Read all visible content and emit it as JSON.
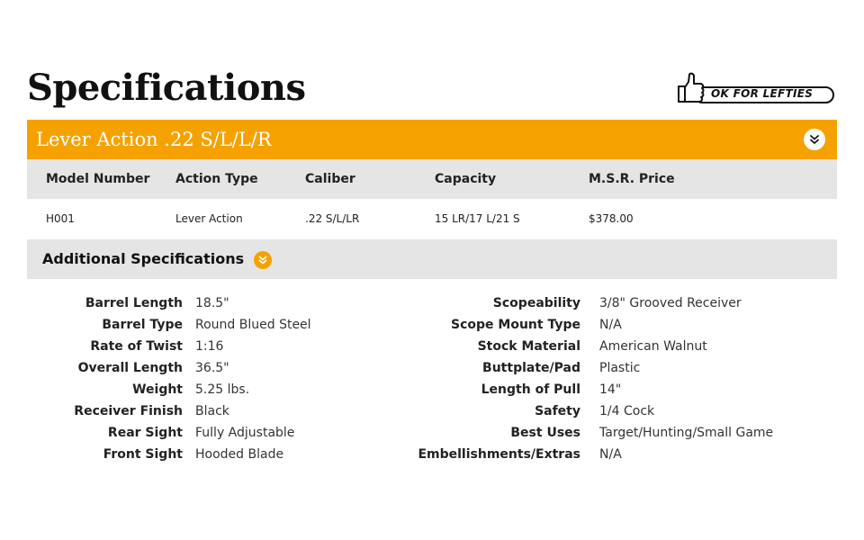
{
  "page_title": "Specifications",
  "badge": {
    "text": "OK FOR LEFTIES",
    "icon": "thumbs-up-icon"
  },
  "product": {
    "name": "Lever Action .22 S/L/L/R",
    "toggle_icon": "chevron-double-down-icon"
  },
  "table": {
    "headers": [
      "Model Number",
      "Action Type",
      "Caliber",
      "Capacity",
      "M.S.R. Price"
    ],
    "row": [
      "H001",
      "Lever Action",
      ".22 S/L/LR",
      "15 LR/17 L/21 S",
      "$378.00"
    ]
  },
  "additional": {
    "title": "Additional Specifications",
    "toggle_icon": "chevron-double-down-icon",
    "left": [
      {
        "label": "Barrel Length",
        "value": "18.5\""
      },
      {
        "label": "Barrel Type",
        "value": "Round Blued Steel"
      },
      {
        "label": "Rate of Twist",
        "value": "1:16"
      },
      {
        "label": "Overall Length",
        "value": "36.5\""
      },
      {
        "label": "Weight",
        "value": "5.25 lbs."
      },
      {
        "label": "Receiver Finish",
        "value": "Black"
      },
      {
        "label": "Rear Sight",
        "value": "Fully Adjustable"
      },
      {
        "label": "Front Sight",
        "value": "Hooded Blade"
      }
    ],
    "right": [
      {
        "label": "Scopeability",
        "value": "3/8\" Grooved Receiver"
      },
      {
        "label": "Scope Mount Type",
        "value": "N/A"
      },
      {
        "label": "Stock Material",
        "value": "American Walnut"
      },
      {
        "label": "Buttplate/Pad",
        "value": "Plastic"
      },
      {
        "label": "Length of Pull",
        "value": "14\""
      },
      {
        "label": "Safety",
        "value": "1/4 Cock"
      },
      {
        "label": "Best Uses",
        "value": "Target/Hunting/Small Game"
      },
      {
        "label": "Embellishments/Extras",
        "value": "N/A"
      }
    ]
  },
  "colors": {
    "accent": "#f5a200",
    "header_gray": "#e5e5e5",
    "text": "#222222"
  }
}
